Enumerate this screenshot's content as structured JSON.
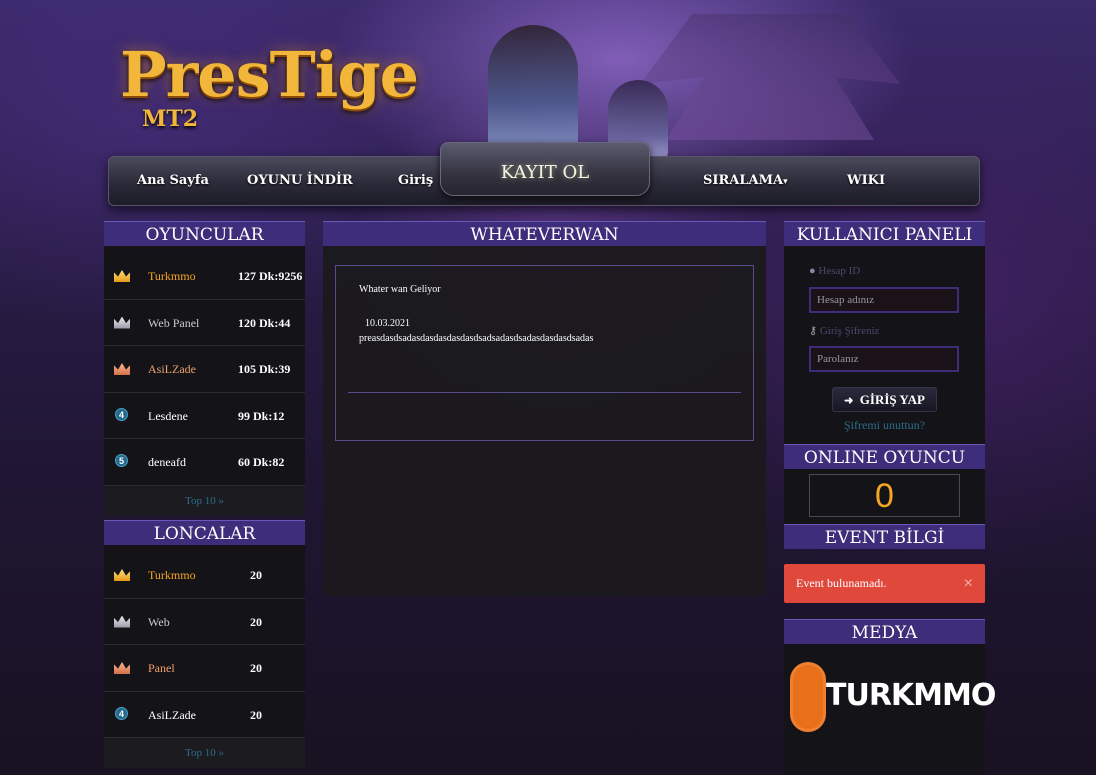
{
  "brand": {
    "logo_text": "PresTige",
    "logo_sub": "MT2"
  },
  "nav": {
    "home": "Ana Sayfa",
    "download": "OYUNU İNDİR",
    "login": "Giriş",
    "register": "KAYIT OL",
    "ranking": "SIRALAMA",
    "ranking_caret": "▾",
    "wiki": "WIKI"
  },
  "players": {
    "title": "OYUNCULAR",
    "top10": "Top 10 »",
    "rows": [
      {
        "rank_icon": "gold-crown",
        "name": "Turkmmo",
        "value": "127 Dk:9256",
        "name_color": "#f5a623"
      },
      {
        "rank_icon": "silver-crown",
        "name": "Web Panel",
        "value": "120 Dk:44",
        "name_color": "#cccccc"
      },
      {
        "rank_icon": "bronze-crown",
        "name": "AsiLZade",
        "value": "105 Dk:39",
        "name_color": "#f0a070"
      },
      {
        "rank_icon": "4",
        "name": "Lesdene",
        "value": "99 Dk:12",
        "name_color": "#ffffff"
      },
      {
        "rank_icon": "5",
        "name": "deneafd",
        "value": "60 Dk:82",
        "name_color": "#ffffff"
      }
    ]
  },
  "guilds": {
    "title": "LONCALAR",
    "top10": "Top 10 »",
    "rows": [
      {
        "rank_icon": "gold-crown",
        "name": "Turkmmo",
        "value": "20",
        "name_color": "#f5a623"
      },
      {
        "rank_icon": "silver-crown",
        "name": "Web",
        "value": "20",
        "name_color": "#cccccc"
      },
      {
        "rank_icon": "bronze-crown",
        "name": "Panel",
        "value": "20",
        "name_color": "#f0a070"
      },
      {
        "rank_icon": "4",
        "name": "AsiLZade",
        "value": "20",
        "name_color": "#ffffff"
      }
    ]
  },
  "news": {
    "title": "WHATEVERWAN",
    "heading": "Whater wan Geliyor",
    "date": "10.03.2021",
    "body": "preasdasdsadasdasdasdasdasdsadsadasdsadasdasdasdsadas"
  },
  "login": {
    "title": "KULLANICI PANELI",
    "id_label": "Hesap ID",
    "id_placeholder": "Hesap adınız",
    "pw_label": "Giriş Şifreniz",
    "pw_placeholder": "Parolanız",
    "button": "GİRİŞ YAP",
    "forgot": "Şifremi unuttun?"
  },
  "online": {
    "title": "ONLINE OYUNCU",
    "count": "0"
  },
  "event": {
    "title": "EVENT BİLGİ",
    "message": "Event bulunamadı.",
    "close": "×"
  },
  "media": {
    "title": "MEDYA",
    "logo_text": "TURKMMO"
  },
  "colors": {
    "accent": "#3d2d7a",
    "highlight": "#f5a623",
    "alert": "#e0483c",
    "link": "#2a6e8a"
  }
}
